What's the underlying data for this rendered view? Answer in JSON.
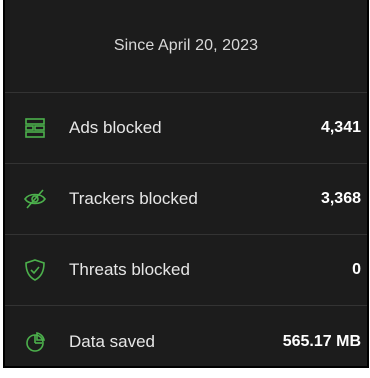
{
  "header": {
    "since_text": "Since April 20, 2023"
  },
  "stats": [
    {
      "label": "Ads blocked",
      "value": "4,341",
      "icon": "ads-blocked-icon"
    },
    {
      "label": "Trackers blocked",
      "value": "3,368",
      "icon": "trackers-blocked-icon"
    },
    {
      "label": "Threats blocked",
      "value": "0",
      "icon": "threats-shield-icon"
    },
    {
      "label": "Data saved",
      "value": "565.17 MB",
      "icon": "data-saved-icon"
    }
  ],
  "colors": {
    "accent": "#4cb04c",
    "background": "#1c1c1c",
    "divider": "#333333"
  }
}
